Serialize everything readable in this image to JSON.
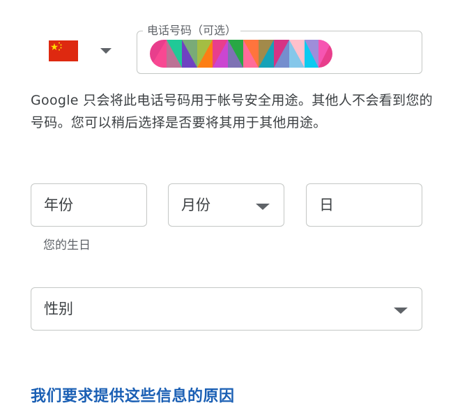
{
  "phone": {
    "country_flag": "china-flag",
    "label": "电话号码（可选）",
    "value": ""
  },
  "helper_text": "Google 只会将此电话号码用于帐号安全用途。其他人不会看到您的号码。您可以稍后选择是否要将其用于其他用途。",
  "birthday": {
    "year_placeholder": "年份",
    "month_placeholder": "月份",
    "day_placeholder": "日",
    "hint": "您的生日"
  },
  "gender": {
    "placeholder": "性别"
  },
  "reason_link": "我们要求提供这些信息的原因",
  "colors": {
    "link": "#1a5fb4",
    "border": "#c4c7c5",
    "flag_red": "#de2910",
    "flag_yellow": "#ffde00"
  }
}
